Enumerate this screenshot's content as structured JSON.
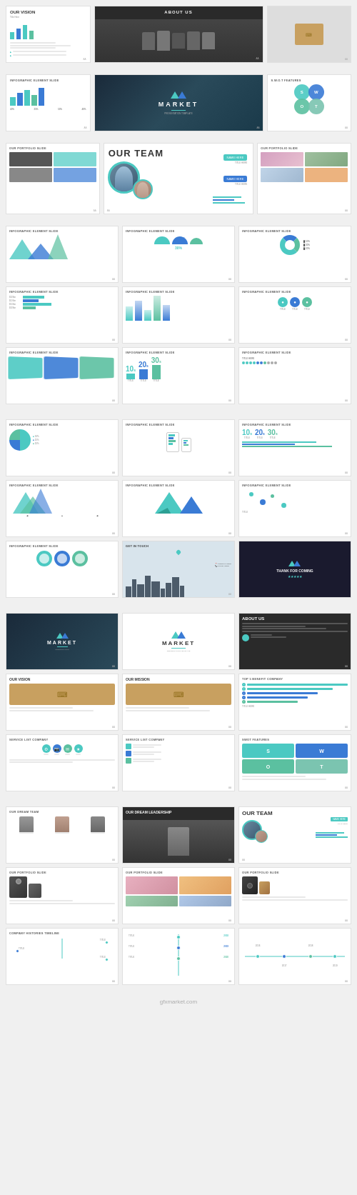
{
  "page": {
    "title": "Market Presentation Template",
    "watermark": "gfxmarket.com"
  },
  "sections": {
    "section1": {
      "slides": [
        {
          "id": "our-vision-1",
          "title": "OUR VISION",
          "subtitle": "Title Here",
          "type": "vision"
        },
        {
          "id": "about-us-1",
          "title": "ABOUT US",
          "type": "about-dark"
        },
        {
          "id": "typewriter-1",
          "title": "",
          "type": "typewriter"
        }
      ]
    },
    "section2": {
      "slides": [
        {
          "id": "infographic-1",
          "title": "INFOGRAPHIC ELEMENT SLIDE",
          "type": "bar-chart"
        },
        {
          "id": "market-logo",
          "title": "MARKET",
          "type": "market-logo"
        },
        {
          "id": "swot-1",
          "title": "S.W.O.T FEATURES",
          "type": "swot"
        }
      ]
    },
    "section3": {
      "label": "OUR TEAM",
      "slides": [
        {
          "id": "portfolio-left",
          "title": "OUR PORTFOLIO SLIDE",
          "type": "portfolio"
        },
        {
          "id": "our-team-feature",
          "title": "OUR TEAM",
          "type": "team-feature"
        },
        {
          "id": "portfolio-right",
          "title": "OUR PORTFOLIO SLIDE",
          "type": "portfolio-deer"
        }
      ]
    },
    "infographics_band1": {
      "rows": [
        [
          {
            "id": "inf-mountains-1",
            "title": "INFOGRAPHIC ELEMENT SLIDE",
            "type": "mountains"
          },
          {
            "id": "inf-circles-1",
            "title": "INFOGRAPHIC ELEMENT SLIDE",
            "type": "half-circles"
          },
          {
            "id": "inf-donut-1",
            "title": "INFOGRAPHIC ELEMENT SLIDE",
            "type": "donut"
          }
        ],
        [
          {
            "id": "inf-bars-2",
            "title": "INFOGRAPHIC ELEMENT SLIDE",
            "type": "bars-grid"
          },
          {
            "id": "inf-gradient-bars",
            "title": "INFOGRAPHIC ELEMENT SLIDE",
            "type": "gradient-bars"
          },
          {
            "id": "inf-circles-2",
            "title": "INFOGRAPHIC ELEMENT SLIDE",
            "type": "icon-circles"
          }
        ],
        [
          {
            "id": "inf-cards-1",
            "title": "INFOGRAPHIC ELEMENT SLIDE",
            "type": "teal-cards"
          },
          {
            "id": "inf-numbers-1",
            "title": "INFOGRAPHIC ELEMENT SLIDE",
            "type": "big-numbers"
          },
          {
            "id": "inf-people-1",
            "title": "INFOGRAPHIC ELEMENT SLIDE",
            "type": "people-dots"
          }
        ]
      ]
    },
    "infographics_band2": {
      "rows": [
        [
          {
            "id": "inf-pie-1",
            "title": "INFOGRAPHIC ELEMENT SLIDE",
            "type": "pie"
          },
          {
            "id": "inf-mobile-1",
            "title": "INFOGRAPHIC ELEMENT SLIDE",
            "type": "mobile-bars"
          },
          {
            "id": "inf-numbers-2",
            "title": "INFOGRAPHIC ELEMENT SLIDE",
            "type": "big-numbers-2"
          }
        ],
        [
          {
            "id": "inf-mountains-2",
            "title": "INFOGRAPHIC ELEMENT SLIDE",
            "type": "mountains-2"
          },
          {
            "id": "inf-mountain-3d",
            "title": "INFOGRAPHIC ELEMENT SLIDE",
            "type": "mountains-3d"
          },
          {
            "id": "inf-scatter",
            "title": "INFOGRAPHIC ELEMENT SLIDE",
            "type": "scatter"
          }
        ],
        [
          {
            "id": "inf-rings-1",
            "title": "INFOGRAPHIC ELEMENT SLIDE",
            "type": "rings"
          },
          {
            "id": "slide-map",
            "title": "GET IN TOUCH",
            "type": "map"
          },
          {
            "id": "slide-thanks",
            "title": "THANK FOR COMING",
            "type": "thank-you"
          }
        ]
      ]
    },
    "section4": {
      "rows": [
        [
          {
            "id": "market-cover-2",
            "title": "MARKET",
            "type": "market-cover-dark"
          },
          {
            "id": "market-cover-light",
            "title": "MARKET",
            "type": "market-cover-light"
          },
          {
            "id": "about-us-2",
            "title": "ABOUT US",
            "type": "about-dark-2"
          }
        ],
        [
          {
            "id": "our-vision-2",
            "title": "OUR VISION",
            "type": "vision-2"
          },
          {
            "id": "our-mission",
            "title": "OUR MISSION",
            "type": "mission"
          },
          {
            "id": "top5",
            "title": "TOP 5 BENEFIT COMPANY",
            "type": "top5-bars"
          }
        ],
        [
          {
            "id": "service-list-1",
            "title": "SERVICE LIST COMPANY",
            "type": "service-list"
          },
          {
            "id": "service-list-2",
            "title": "SERVICE LIST COMPANY",
            "type": "service-list-2"
          },
          {
            "id": "swot-features-2",
            "title": "SWOT FEATURES",
            "type": "swot-2"
          }
        ]
      ]
    },
    "section5": {
      "rows": [
        [
          {
            "id": "dream-team",
            "title": "OUR DREAM TEAM",
            "type": "dream-team"
          },
          {
            "id": "dream-leadership",
            "title": "OUR DREAM LEADERSHIP",
            "type": "dream-leadership"
          },
          {
            "id": "our-team-2",
            "title": "OUR TEAM",
            "type": "our-team-2"
          }
        ],
        [
          {
            "id": "portfolio-1",
            "title": "OUR PORTFOLIO SLIDE",
            "type": "portfolio-photos"
          },
          {
            "id": "portfolio-2",
            "title": "OUR PORTFOLIO SLIDE",
            "type": "portfolio-mosaic"
          },
          {
            "id": "portfolio-3",
            "title": "OUR PORTFOLIO SLIDE",
            "type": "portfolio-camera"
          }
        ],
        [
          {
            "id": "timeline-1",
            "title": "COMPANY HISTORIES TIMELINE",
            "type": "timeline"
          },
          {
            "id": "timeline-2",
            "title": "",
            "type": "timeline-2"
          },
          {
            "id": "timeline-3",
            "title": "",
            "type": "timeline-3"
          }
        ]
      ]
    }
  },
  "team": {
    "title": "OUR TEAM",
    "member1": {
      "name": "NAME HERE",
      "role": "TITLE HERE"
    },
    "member2": {
      "name": "NAME HERE",
      "role": "TITLE HERE"
    }
  },
  "colors": {
    "teal": "#4BC9C2",
    "blue": "#3a7bd5",
    "dark": "#1e1e2e",
    "light_bg": "#f5f5f5",
    "white": "#ffffff",
    "gray": "#888888"
  }
}
